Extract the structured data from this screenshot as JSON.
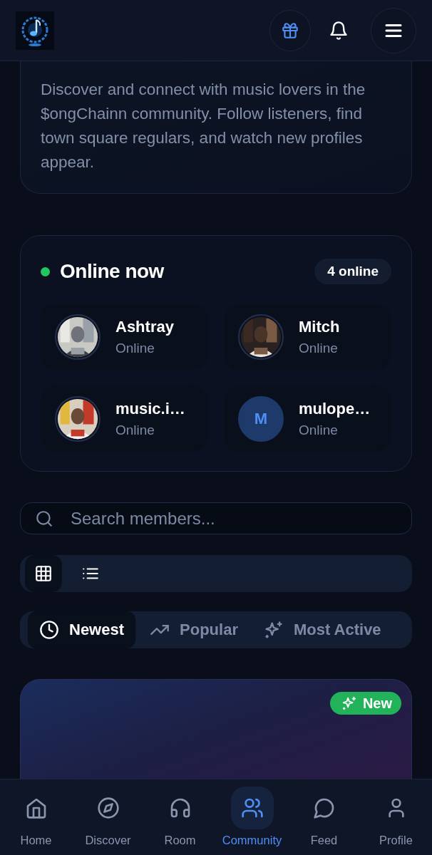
{
  "intro": {
    "text": "Discover and connect with music lovers in the $ongChainn community. Follow listeners, find town square regulars, and watch new profiles appear."
  },
  "online": {
    "title": "Online now",
    "count": "4 online",
    "members": [
      {
        "name": "Ashtray",
        "status": "Online"
      },
      {
        "name": "Mitch",
        "status": "Online"
      },
      {
        "name": "music.i…",
        "status": "Online"
      },
      {
        "name": "mulope…",
        "status": "Online",
        "kind": "initial",
        "initial": "M"
      }
    ]
  },
  "search": {
    "placeholder": "Search members..."
  },
  "view_toggle": [
    {
      "selected": true
    },
    {
      "selected": false
    }
  ],
  "sort_tabs": [
    {
      "label": "Newest",
      "selected": true
    },
    {
      "label": "Popular",
      "selected": false
    },
    {
      "label": "Most Active",
      "selected": false
    }
  ],
  "member_card": {
    "badge": "New"
  },
  "bottom_nav": [
    {
      "label": "Home",
      "selected": false
    },
    {
      "label": "Discover",
      "selected": false
    },
    {
      "label": "Room",
      "selected": false
    },
    {
      "label": "Community",
      "selected": true
    },
    {
      "label": "Feed",
      "selected": false
    },
    {
      "label": "Profile",
      "selected": false
    }
  ]
}
